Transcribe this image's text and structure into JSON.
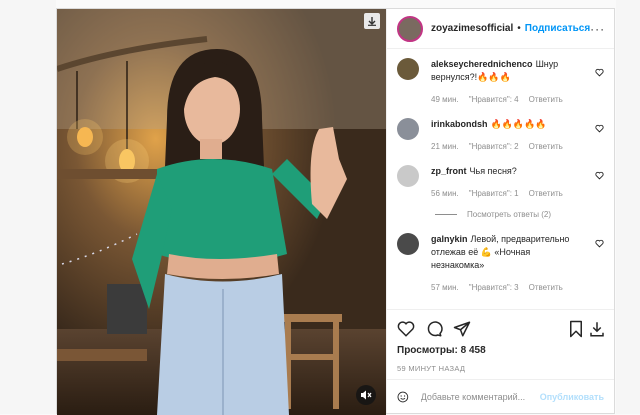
{
  "post": {
    "username": "zoyazimesofficial",
    "separator": "•",
    "follow_label": "Подписаться",
    "more_label": "···"
  },
  "comments": [
    {
      "user": "alekseycherednichenco",
      "text": "Шнур вернулся?!🔥🔥🔥",
      "time": "49 мин.",
      "likes": "\"Нравится\": 4",
      "reply": "Ответить",
      "avatar_color": "#6b5a3a"
    },
    {
      "user": "irinkabondsh",
      "text": "🔥🔥🔥🔥🔥",
      "time": "21 мин.",
      "likes": "\"Нравится\": 2",
      "reply": "Ответить",
      "avatar_color": "#8a8f99"
    },
    {
      "user": "zp_front",
      "text": "Чья песня?",
      "time": "56 мин.",
      "likes": "\"Нравится\": 1",
      "reply": "Ответить",
      "avatar_color": "#c9c9c9"
    },
    {
      "user": "galnykin",
      "text": "Левой, предварительно отлежав её 💪 «Ночная незнакомка»",
      "time": "57 мин.",
      "likes": "\"Нравится\": 3",
      "reply": "Ответить",
      "avatar_color": "#4a4a4a"
    }
  ],
  "view_replies_label": "Посмотреть ответы (2)",
  "stats": {
    "views": "Просмотры: 8 458",
    "time_ago": "59 МИНУТ НАЗАД"
  },
  "comment_input": {
    "placeholder": "Добавьте комментарий...",
    "publish_label": "Опубликовать"
  },
  "icons": {
    "like": "heart-icon",
    "comment": "comment-icon",
    "share": "share-icon",
    "save": "bookmark-icon",
    "download": "download-icon",
    "mute": "speaker-muted-icon",
    "emoji": "smiley-icon"
  },
  "colors": {
    "accent": "#0095f6",
    "publish_disabled": "#b2dffc",
    "meta_text": "#8e8e8e",
    "story_ring": "#c13584"
  }
}
